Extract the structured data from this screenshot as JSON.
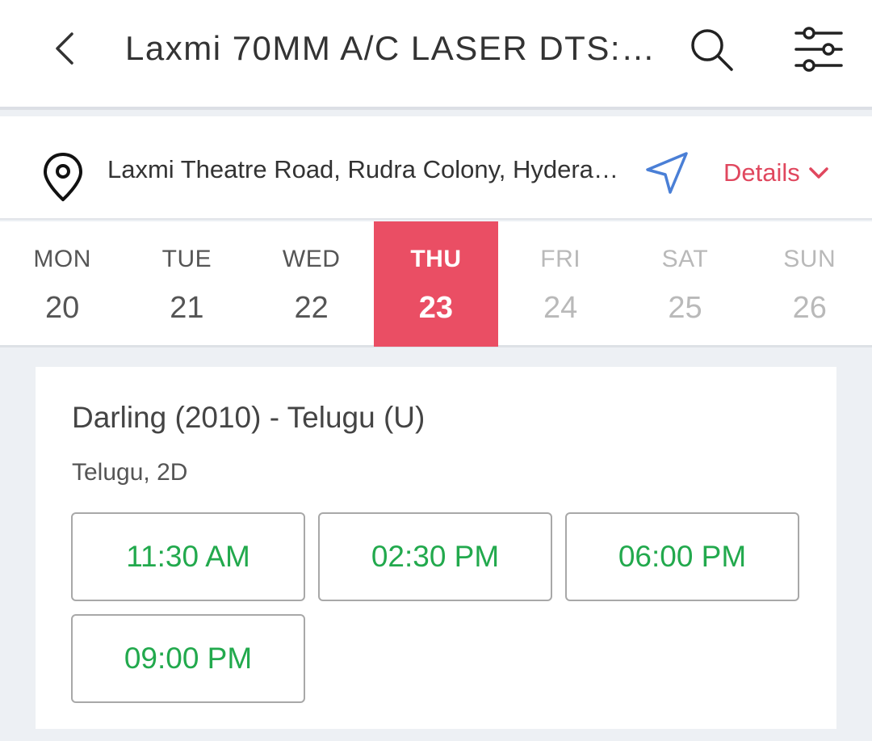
{
  "header": {
    "title": "Laxmi 70MM A/C LASER DTS: Hyderabad",
    "back_icon": "chevron-left-icon",
    "search_icon": "search-icon",
    "filter_icon": "sliders-icon"
  },
  "location": {
    "address": "Laxmi Theatre Road, Rudra Colony, Hyderabad",
    "details_label": "Details",
    "accent": "#e0475e",
    "nav_color": "#4a7fd6"
  },
  "dates": [
    {
      "day": "MON",
      "date": "20",
      "state": "past"
    },
    {
      "day": "TUE",
      "date": "21",
      "state": "past"
    },
    {
      "day": "WED",
      "date": "22",
      "state": "past"
    },
    {
      "day": "THU",
      "date": "23",
      "state": "selected"
    },
    {
      "day": "FRI",
      "date": "24",
      "state": "future"
    },
    {
      "day": "SAT",
      "date": "25",
      "state": "future"
    },
    {
      "day": "SUN",
      "date": "26",
      "state": "future"
    }
  ],
  "movie": {
    "title": "Darling (2010) - Telugu (U)",
    "format": "Telugu, 2D",
    "showtimes": [
      "11:30 AM",
      "02:30 PM",
      "06:00 PM",
      "09:00 PM"
    ],
    "showtime_color": "#22a94d"
  },
  "colors": {
    "selected_date_bg": "#ea4e64"
  }
}
